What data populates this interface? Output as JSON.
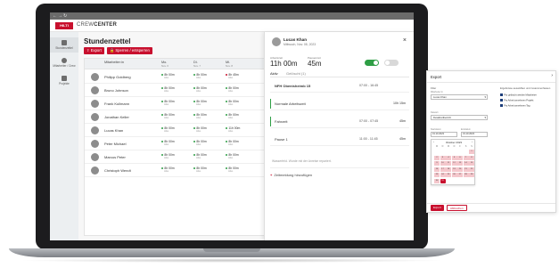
{
  "app": {
    "logo": "HILTI",
    "brand_light": "CREW",
    "brand_bold": "CENTER"
  },
  "topbar": {
    "back": "←",
    "forward": "→",
    "refresh": "↻"
  },
  "sidenav": {
    "items": [
      {
        "label": "Stundenzettel",
        "icon": "document-icon"
      },
      {
        "label": "Mitarbeiter / Crew",
        "icon": "people-icon"
      },
      {
        "label": "Projekte",
        "icon": "building-icon"
      }
    ]
  },
  "page": {
    "title": "Stundenzettel",
    "export_label": "Export",
    "lock_label": "Sperren / entsperren"
  },
  "table": {
    "headers": [
      {
        "label": "Mitarbeiter:in",
        "sub": ""
      },
      {
        "label": "Mo.",
        "sub": "Nov. 6"
      },
      {
        "label": "Di.",
        "sub": "Nov. 7"
      },
      {
        "label": "Mi.",
        "sub": "Nov. 8"
      }
    ],
    "rows": [
      {
        "name": "Philipp Goldberg",
        "cells": [
          {
            "value": "8h 00m",
            "sub": "Abw.",
            "status": "ok"
          },
          {
            "value": "8h 00m",
            "sub": "Abw.",
            "status": "ok"
          },
          {
            "value": "8h 45m",
            "sub": "Abw.",
            "status": "warn"
          }
        ]
      },
      {
        "name": "Bruno Johnson",
        "cells": [
          {
            "value": "8h 00m",
            "sub": "Abw.",
            "status": "ok"
          },
          {
            "value": "8h 00m",
            "sub": "Abw.",
            "status": "ok"
          },
          {
            "value": "8h 00m",
            "sub": "Abw.",
            "status": "ok"
          }
        ]
      },
      {
        "name": "Frank Kullmann",
        "cells": [
          {
            "value": "8h 00m",
            "sub": "Abw.",
            "status": "ok"
          },
          {
            "value": "8h 00m",
            "sub": "Abw.",
            "status": "ok"
          },
          {
            "value": "8h 00m",
            "sub": "Abw.",
            "status": "ok"
          }
        ]
      },
      {
        "name": "Jonathan Keller",
        "cells": [
          {
            "value": "8h 00m",
            "sub": "Abw.",
            "status": "ok"
          },
          {
            "value": "8h 00m",
            "sub": "Abw.",
            "status": "ok"
          },
          {
            "value": "8h 00m",
            "sub": "Abw.",
            "status": "ok"
          }
        ]
      },
      {
        "name": "Lucas Khan",
        "cells": [
          {
            "value": "8h 00m",
            "sub": "Abw.",
            "status": "ok"
          },
          {
            "value": "8h 00m",
            "sub": "Abw.",
            "status": "ok"
          },
          {
            "value": "11h 00m",
            "sub": "Abw.",
            "status": "ok"
          }
        ]
      },
      {
        "name": "Peter Michael",
        "cells": [
          {
            "value": "8h 00m",
            "sub": "Abw.",
            "status": "ok"
          },
          {
            "value": "8h 00m",
            "sub": "Abw.",
            "status": "ok"
          },
          {
            "value": "8h 00m",
            "sub": "Abw.",
            "status": "ok"
          }
        ]
      },
      {
        "name": "Marcus Peter",
        "cells": [
          {
            "value": "8h 00m",
            "sub": "Abw.",
            "status": "ok"
          },
          {
            "value": "8h 00m",
            "sub": "Abw.",
            "status": "ok"
          },
          {
            "value": "8h 00m",
            "sub": "Abw.",
            "status": "ok"
          }
        ]
      },
      {
        "name": "Christoph Wendt",
        "cells": [
          {
            "value": "8h 00m",
            "sub": "Abw.",
            "status": "ok"
          },
          {
            "value": "8h 00m",
            "sub": "Abw.",
            "status": "ok"
          },
          {
            "value": "8h 00m",
            "sub": "Abw.",
            "status": "ok"
          }
        ]
      }
    ]
  },
  "panel": {
    "name": "Lucas Khan",
    "date": "Mittwoch, Nov. 08, 2023",
    "close": "×",
    "stat1_label": "Arbeitszeit",
    "stat1_value": "11h 00m",
    "stat2_label": "Pausenzeit",
    "stat2_value": "45m",
    "tab_active": "Aktiv",
    "tab_other": "Gelöscht (1)",
    "entries": [
      {
        "text": "NFH Obenisheimb 15",
        "time": "07:00 - 16:45",
        "duration": "",
        "bold": true,
        "color": ""
      },
      {
        "text": "Normale Arbeitszeit",
        "time": "",
        "duration": "10h 15m",
        "bold": false,
        "color": "#2e9e45"
      },
      {
        "text": "Fahrzeit",
        "time": "07:00 - 07:45",
        "duration": "45m",
        "bold": false,
        "color": "#2e9e45"
      },
      {
        "text": "Pause 1",
        "time": "11:00 - 11:45",
        "duration": "45m",
        "bold": false,
        "color": ""
      }
    ],
    "note": "Wasserfeld. Wurde mit der Anreise repariert.",
    "add_label": "Zeitmeldung hinzufügen"
  },
  "dialog": {
    "title": "Export",
    "close": "›",
    "filter_label": "Filter",
    "employee_label": "Mitarbeiter:in",
    "employee_value": "Lucas Khan",
    "format_label": "Dateiart",
    "format_value": "Detailzeitbericht",
    "start_label": "Startdatum",
    "start_value": "01.10.2023",
    "end_label": "Enddatum",
    "end_value": "31.10.2023",
    "options_label": "Ergebnisse auswählen und zusammenfassen",
    "options": [
      "Pro gelöscht werden Mitarbeiter",
      "Pro Arbeit annehmen Projekt",
      "Pro Arbeit annehmen Tag"
    ],
    "calendar": {
      "month": "Oktober 2023",
      "dow": [
        "M",
        "D",
        "M",
        "D",
        "F",
        "S",
        "S"
      ],
      "weeks": [
        [
          "",
          "",
          "",
          "",
          "",
          "",
          "1"
        ],
        [
          "2",
          "3",
          "4",
          "5",
          "6",
          "7",
          "8"
        ],
        [
          "9",
          "10",
          "11",
          "12",
          "13",
          "14",
          "15"
        ],
        [
          "16",
          "17",
          "18",
          "19",
          "20",
          "21",
          "22"
        ],
        [
          "23",
          "24",
          "25",
          "26",
          "27",
          "28",
          "29"
        ],
        [
          "30",
          "31",
          "",
          "",
          "",
          "",
          ""
        ]
      ]
    },
    "export_btn": "Export",
    "cancel_btn": "Abbrechen"
  },
  "colors": {
    "brand_red": "#c8102e",
    "ok_green": "#2e9e45",
    "accent_blue": "#1c3d7a"
  }
}
